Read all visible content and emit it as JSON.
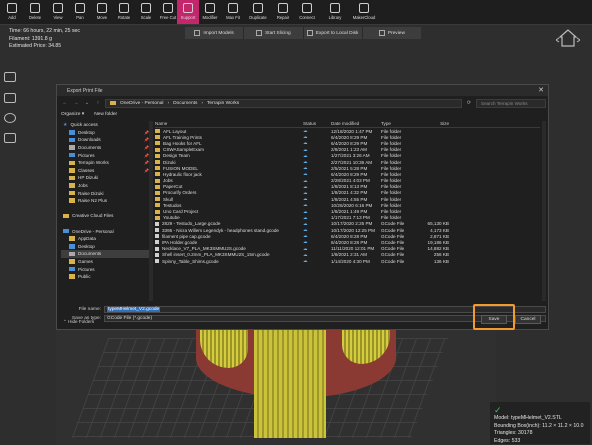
{
  "toolbar": {
    "items": [
      {
        "label": "Add",
        "icon": "add-icon"
      },
      {
        "label": "Delete",
        "icon": "delete-icon"
      },
      {
        "label": "View",
        "icon": "view-icon"
      },
      {
        "label": "Pan",
        "icon": "pan-icon"
      },
      {
        "label": "Move",
        "icon": "move-icon"
      },
      {
        "label": "Rotate",
        "icon": "rotate-icon"
      },
      {
        "label": "Scale",
        "icon": "scale-icon"
      },
      {
        "label": "Free Cut",
        "icon": "cut-icon"
      },
      {
        "label": "Support",
        "icon": "support-icon",
        "active": true
      },
      {
        "label": "Modifier",
        "icon": "modifier-icon"
      },
      {
        "label": "Max Fit",
        "icon": "maxfit-icon"
      },
      {
        "label": "Duplicate",
        "icon": "duplicate-icon"
      },
      {
        "label": "Repair",
        "icon": "repair-icon"
      },
      {
        "label": "Connect",
        "icon": "connect-icon"
      },
      {
        "label": "Library",
        "icon": "library-icon"
      },
      {
        "label": "MakerCloud",
        "icon": "cloud-icon"
      }
    ],
    "active_color": "#c4266c"
  },
  "print_info": {
    "time": "Time: 66 hours, 22 min, 25 sec",
    "filament": "Filament: 1391.8 g",
    "price": "Estimated Price: 34.85"
  },
  "actionbar": {
    "import": "Import Models",
    "slice": "Start Slicing",
    "export": "Export to Local Disk",
    "preview": "Preview"
  },
  "dialog": {
    "title": "Export Print File",
    "breadcrumb": [
      "OneDrive - Personal",
      "Documents",
      "Terrapin Works"
    ],
    "search_placeholder": "Search Terrapin Works",
    "organize": "Organize ▾",
    "new_folder": "New folder",
    "nav_items": [
      {
        "label": "Quick access",
        "icon": "star",
        "pinned": false
      },
      {
        "label": "Desktop",
        "icon": "blue",
        "pinned": true
      },
      {
        "label": "Downloads",
        "icon": "blue",
        "pinned": true
      },
      {
        "label": "Documents",
        "icon": "grey",
        "pinned": true
      },
      {
        "label": "Pictures",
        "icon": "blue",
        "pinned": true
      },
      {
        "label": "Terrapin Works",
        "icon": "folder",
        "pinned": true
      },
      {
        "label": "Classes",
        "icon": "folder",
        "pinned": true
      },
      {
        "label": "HP Dizuki",
        "icon": "folder",
        "pinned": false
      },
      {
        "label": "Jobs",
        "icon": "folder",
        "pinned": false
      },
      {
        "label": "Raise Dizuki",
        "icon": "folder",
        "pinned": false
      },
      {
        "label": "Raise N2 Plus",
        "icon": "folder",
        "pinned": false
      },
      {
        "label": "",
        "icon": "none",
        "pinned": false
      },
      {
        "label": "Creative Cloud Files",
        "icon": "folder",
        "pinned": false
      },
      {
        "label": "",
        "icon": "none",
        "pinned": false
      },
      {
        "label": "OneDrive - Personal",
        "icon": "blue",
        "pinned": false
      },
      {
        "label": "AppData",
        "icon": "folder",
        "pinned": false
      },
      {
        "label": "Desktop",
        "icon": "blue",
        "pinned": false
      },
      {
        "label": "Documents",
        "icon": "grey",
        "pinned": false,
        "selected": true
      },
      {
        "label": "Games",
        "icon": "folder",
        "pinned": false
      },
      {
        "label": "Pictures",
        "icon": "blue",
        "pinned": false
      },
      {
        "label": "Public",
        "icon": "folder",
        "pinned": false
      }
    ],
    "columns": {
      "name": "Name",
      "status": "Status",
      "date": "Date modified",
      "type": "Type",
      "size": "Size"
    },
    "files": [
      {
        "name": "AFL Layout",
        "kind": "folder",
        "date": "12/18/2020 1:47 PM",
        "type": "File folder",
        "size": ""
      },
      {
        "name": "AFL Training Prints",
        "kind": "folder",
        "date": "6/4/2020 8:29 PM",
        "type": "File folder",
        "size": ""
      },
      {
        "name": "Bag Hooks for AFL",
        "kind": "folder",
        "date": "6/4/2020 8:29 PM",
        "type": "File folder",
        "size": ""
      },
      {
        "name": "CSWASampleExam",
        "kind": "folder",
        "date": "2/8/2021 1:23 AM",
        "type": "File folder",
        "size": ""
      },
      {
        "name": "Design Team",
        "kind": "folder",
        "date": "1/27/2021 3:26 AM",
        "type": "File folder",
        "size": ""
      },
      {
        "name": "Dizuki",
        "kind": "folder",
        "date": "2/27/2021 10:36 AM",
        "type": "File folder",
        "size": ""
      },
      {
        "name": "FUSION MODEL",
        "kind": "folder",
        "date": "2/5/2021 5:28 PM",
        "type": "File folder",
        "size": ""
      },
      {
        "name": "Hydraulic floor jack",
        "kind": "folder",
        "date": "6/4/2020 8:29 PM",
        "type": "File folder",
        "size": ""
      },
      {
        "name": "Jobs",
        "kind": "folder",
        "date": "2/28/2021 4:03 PM",
        "type": "File folder",
        "size": ""
      },
      {
        "name": "PaperCut",
        "kind": "folder",
        "date": "1/8/2021 8:13 PM",
        "type": "File folder",
        "size": ""
      },
      {
        "name": "Procurify Orders",
        "kind": "folder",
        "date": "1/8/2021 4:32 PM",
        "type": "File folder",
        "size": ""
      },
      {
        "name": "Skull",
        "kind": "folder",
        "date": "1/8/2021 4:55 PM",
        "type": "File folder",
        "size": ""
      },
      {
        "name": "Testudos",
        "kind": "folder",
        "date": "10/26/2020 6:16 PM",
        "type": "File folder",
        "size": ""
      },
      {
        "name": "Uno Card Project",
        "kind": "folder",
        "date": "1/8/2021 1:49 PM",
        "type": "File folder",
        "size": ""
      },
      {
        "name": "Youtube",
        "kind": "folder",
        "date": "1/17/2021 7:13 PM",
        "type": "File folder",
        "size": ""
      },
      {
        "name": "2829 - Testudo_Large.gcode",
        "kind": "file",
        "date": "10/17/2020 2:25 PM",
        "type": "GCode File",
        "size": "65,130 KB"
      },
      {
        "name": "3395 - Nicra Willem Legendyk - headphones stand.gcode",
        "kind": "file",
        "date": "10/17/2020 12:25 PM",
        "type": "GCode File",
        "size": "4,173 KB"
      },
      {
        "name": "filament pipe cap.gcode",
        "kind": "file",
        "date": "6/4/2020 8:28 PM",
        "type": "GCode File",
        "size": "2,871 KB"
      },
      {
        "name": "IPA Holder.gcode",
        "kind": "file",
        "date": "6/4/2020 8:28 PM",
        "type": "GCode File",
        "size": "19,186 KB"
      },
      {
        "name": "Necklace_V7_PLA_MK3SMMU2S.gcode",
        "kind": "file",
        "date": "11/11/2020 12:01 PM",
        "type": "GCode File",
        "size": "14,882 KB"
      },
      {
        "name": "Shell insert_0.2mm_PLA_MK3SMMU2S_15m.gcode",
        "kind": "file",
        "date": "1/8/2021 2:31 AM",
        "type": "GCode File",
        "size": "256 KB"
      },
      {
        "name": "Spinny_Table_Shims.gcode",
        "kind": "file",
        "date": "1/14/2020 4:30 PM",
        "type": "GCode File",
        "size": "136 KB"
      }
    ],
    "file_name_label": "File name:",
    "file_name_value": "typeMHelmet_V2.gcode",
    "save_type_label": "Save as type:",
    "save_type_value": "GCode File (*.gcode)",
    "hide_folders": "Hide Folders",
    "save_label": "Save",
    "cancel_label": "Cancel",
    "highlight_color": "#f29a2e"
  },
  "model_info": {
    "model": "Model: typeMHelmet_V2.STL",
    "bbox": "Bounding Box(inch): 11.2 × 11.2 × 10.0",
    "triangles": "Triangles: 30178",
    "edges": "Edges: 533"
  }
}
